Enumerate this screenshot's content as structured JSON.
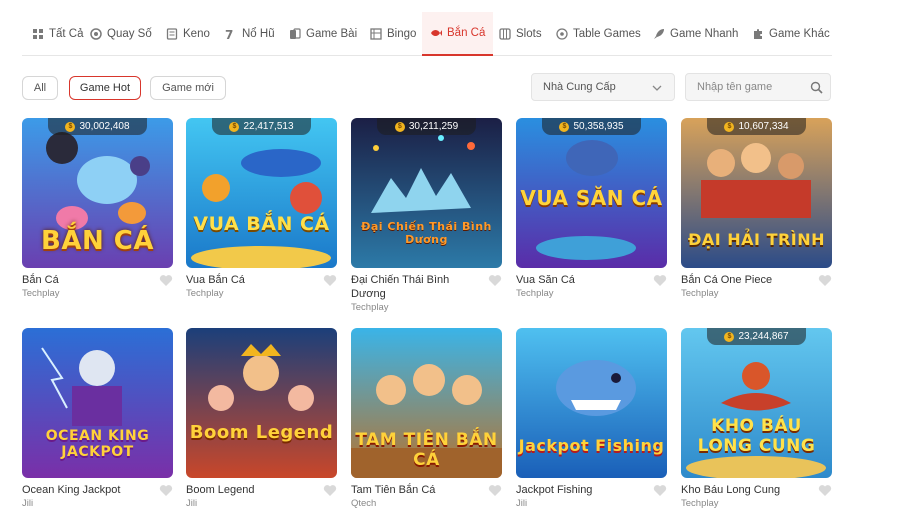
{
  "tabs": [
    {
      "label": "Tất Cả",
      "icon": "grid-icon"
    },
    {
      "label": "Quay Số",
      "icon": "lottery-ball-icon"
    },
    {
      "label": "Keno",
      "icon": "keno-icon"
    },
    {
      "label": "Nổ Hũ",
      "icon": "jackpot-pot-icon"
    },
    {
      "label": "Game Bài",
      "icon": "cards-icon"
    },
    {
      "label": "Bingo",
      "icon": "bingo-icon"
    },
    {
      "label": "Bắn Cá",
      "icon": "fish-icon",
      "active": true
    },
    {
      "label": "Slots",
      "icon": "slots-icon"
    },
    {
      "label": "Table Games",
      "icon": "table-games-icon"
    },
    {
      "label": "Game Nhanh",
      "icon": "rocket-icon"
    },
    {
      "label": "Game Khác",
      "icon": "puzzle-icon"
    }
  ],
  "filters": {
    "all": "All",
    "hot": "Game Hot",
    "new": "Game mới",
    "selected": "Game Hot"
  },
  "provider_select": {
    "value": "Nhà Cung Cấp"
  },
  "search": {
    "placeholder": "Nhập tên game"
  },
  "games": [
    {
      "name": "Bắn Cá",
      "provider": "Techplay",
      "jackpot": "30,002,408",
      "logo": "BẮN CÁ"
    },
    {
      "name": "Vua Bắn Cá",
      "provider": "Techplay",
      "jackpot": "22,417,513",
      "logo": "VUA BẮN CÁ"
    },
    {
      "name": "Đại Chiến Thái Bình Dương",
      "provider": "Techplay",
      "jackpot": "30,211,259",
      "logo": "Đại Chiến Thái Bình Dương"
    },
    {
      "name": "Vua Săn Cá",
      "provider": "Techplay",
      "jackpot": "50,358,935",
      "logo": "VUA SĂN CÁ"
    },
    {
      "name": "Bắn Cá One Piece",
      "provider": "Techplay",
      "jackpot": "10,607,334",
      "logo": "ĐẠI HẢI TRÌNH"
    },
    {
      "name": "Ocean King Jackpot",
      "provider": "Jili",
      "jackpot": "",
      "logo": "OCEAN KING JACKPOT"
    },
    {
      "name": "Boom Legend",
      "provider": "Jili",
      "jackpot": "",
      "logo": "Boom Legend"
    },
    {
      "name": "Tam Tiên Bắn Cá",
      "provider": "Qtech",
      "jackpot": "",
      "logo": "TAM TIÊN BẮN CÁ"
    },
    {
      "name": "Jackpot Fishing",
      "provider": "Jili",
      "jackpot": "",
      "logo": "Jackpot Fishing"
    },
    {
      "name": "Kho Báu Long Cung",
      "provider": "Techplay",
      "jackpot": "23,244,867",
      "logo": "KHO BÁU LONG CUNG"
    }
  ],
  "colors": {
    "accent": "#d8362c",
    "border": "#d6d6d6",
    "muted_text": "#888888"
  }
}
